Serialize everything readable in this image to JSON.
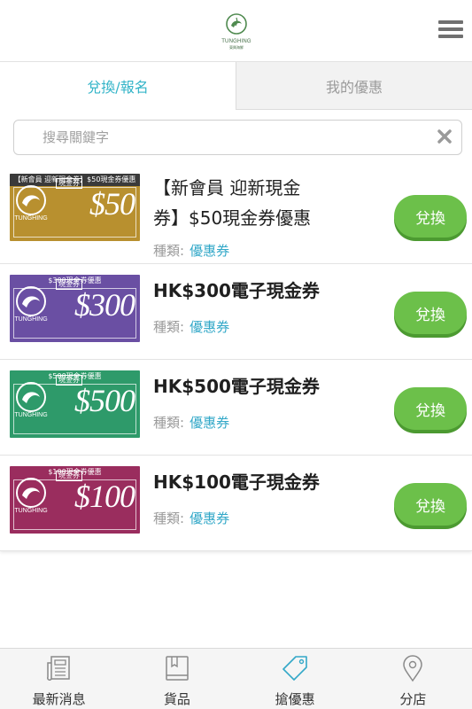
{
  "header": {
    "logo_brand": "TUNGHING",
    "logo_sub": "東興海鮮",
    "menu_icon": "hamburger-icon"
  },
  "tabs": [
    {
      "label": "兌換/報名",
      "active": true
    },
    {
      "label": "我的優惠",
      "active": false
    }
  ],
  "search": {
    "placeholder": "搜尋關鍵字",
    "value": "",
    "clear_icon": "close-icon"
  },
  "coupons": [
    {
      "voucher_caption": "【新會員 迎新現金券】$50現金券優惠",
      "voucher_tag": "現金券",
      "voucher_amount": "$50",
      "voucher_color": "#b8902f",
      "voucher_brand": "TUNGHING",
      "title_line1": "【新會員 迎新現金",
      "title_line2": "券】$50現金券優惠",
      "category_label": "種類:",
      "category": "優惠券",
      "button": "兌換"
    },
    {
      "voucher_caption": "$300現金券優惠",
      "voucher_tag": "現金券",
      "voucher_amount": "$300",
      "voucher_color": "#6a4fa3",
      "voucher_brand": "TUNGHING",
      "title_line1": "HK$300電子現金券",
      "category_label": "種類:",
      "category": "優惠券",
      "button": "兌換"
    },
    {
      "voucher_caption": "$500現金券優惠",
      "voucher_tag": "現金券",
      "voucher_amount": "$500",
      "voucher_color": "#2e9a6a",
      "voucher_brand": "TUNGHING",
      "title_line1": "HK$500電子現金券",
      "category_label": "種類:",
      "category": "優惠券",
      "button": "兌換"
    },
    {
      "voucher_caption": "$100現金券優惠",
      "voucher_tag": "現金券",
      "voucher_amount": "$100",
      "voucher_color": "#9a2d5e",
      "voucher_brand": "TUNGHING",
      "title_line1": "HK$100電子現金券",
      "category_label": "種類:",
      "category": "優惠券",
      "button": "兌換"
    }
  ],
  "bottom_nav": [
    {
      "label": "最新消息",
      "icon": "newspaper-icon",
      "active": false
    },
    {
      "label": "貨品",
      "icon": "book-icon",
      "active": false
    },
    {
      "label": "搶優惠",
      "icon": "tag-icon",
      "active": true
    },
    {
      "label": "分店",
      "icon": "map-pin-icon",
      "active": false
    }
  ],
  "colors": {
    "accent": "#33b4c8",
    "button_green": "#6cc04a"
  }
}
